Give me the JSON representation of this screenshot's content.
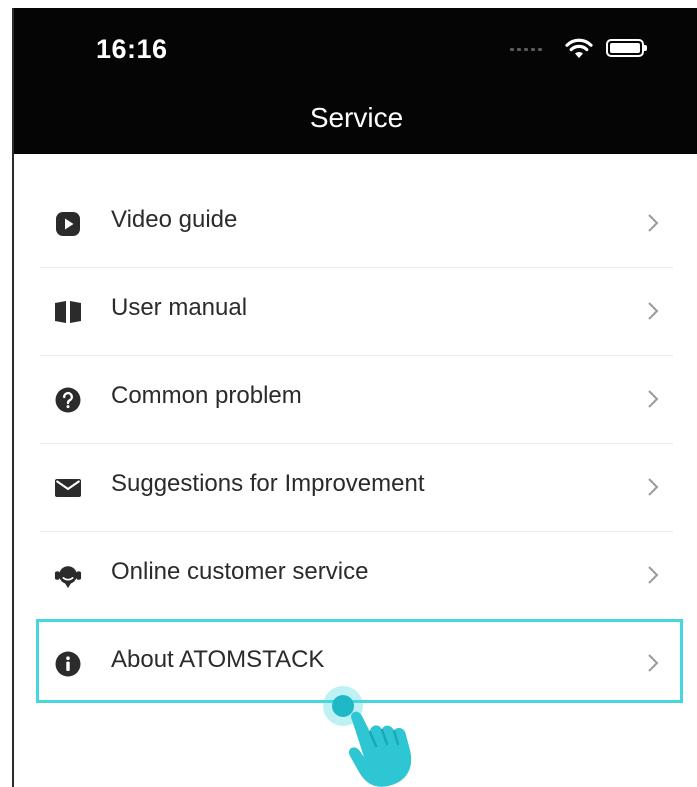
{
  "status_bar": {
    "time": "16:16",
    "icons": [
      "signal-dots-icon",
      "wifi-icon",
      "battery-icon"
    ]
  },
  "header": {
    "title": "Service"
  },
  "menu": {
    "items": [
      {
        "label": "Video guide",
        "icon": "play-icon"
      },
      {
        "label": "User manual",
        "icon": "book-icon"
      },
      {
        "label": "Common problem",
        "icon": "question-icon"
      },
      {
        "label": "Suggestions for Improvement",
        "icon": "envelope-icon"
      },
      {
        "label": "Online customer service",
        "icon": "headset-icon"
      },
      {
        "label": "About ATOMSTACK",
        "icon": "info-icon",
        "highlighted": true
      }
    ]
  },
  "colors": {
    "header_background": "#050505",
    "highlight": "#45d6df",
    "text": "#2b2b2b",
    "icon": "#2b2b2b",
    "chevron": "#9a9a9a"
  }
}
